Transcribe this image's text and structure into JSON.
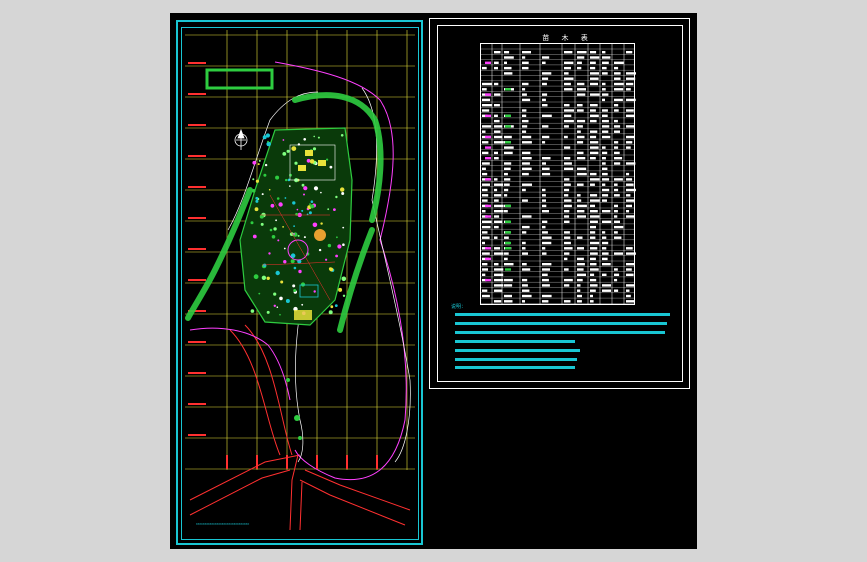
{
  "drawing": {
    "table_title": "苗 木 表",
    "notes_label": "说明：",
    "colors": {
      "frame": "#19c6d3",
      "grid": "#e8e23a",
      "vegetation": "#2ecc40",
      "road": "#ff3030",
      "path": "#ff40ff",
      "table_line": "#ffffff",
      "text": "#19c6d3"
    },
    "icons": [
      "north-arrow-icon"
    ]
  }
}
